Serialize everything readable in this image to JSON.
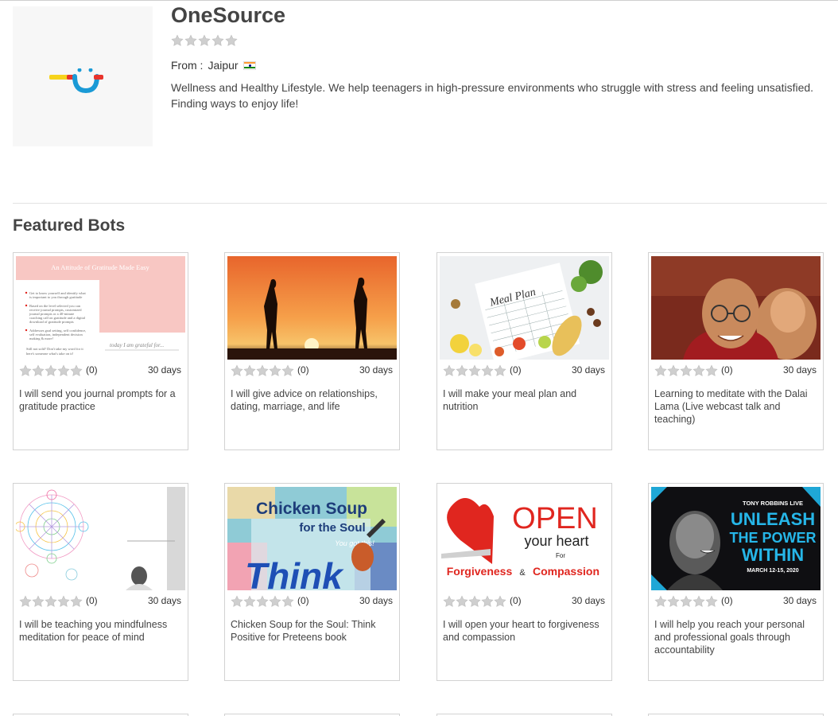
{
  "profile": {
    "name": "OneSource",
    "rating": 0,
    "from_label": "From :",
    "city": "Jaipur",
    "country_flag": "india-flag",
    "description": "Wellness and Healthy Lifestyle. We help teenagers in high-pressure environments who struggle with stress and feeling unsatisfied. Finding ways to enjoy life!"
  },
  "section_title": "Featured Bots",
  "cards": [
    {
      "title": "I will send you journal prompts for a gratitude practice",
      "rating": 0,
      "count": "(0)",
      "duration": "30 days",
      "thumb_heading": "An Attitude of Gratitude Made Easy",
      "thumb_bullets": [
        "Get to know yourself and identify what is important to you through gratitude",
        "Based on the level selected you can receive journal prompts, customized journal prompts or a 40-minute coaching call on gratitude and a digital download of gratitude prompts",
        "Addresses goal setting, self confidence, self evaluation, independent decision making & more!"
      ],
      "thumb_footer": "Still not sold? Don't take my word for it here's someone what's take on it!",
      "thumb_handwriting": "today I am grateful for..."
    },
    {
      "title": "I will give advice on relationships, dating, marriage, and life",
      "rating": 0,
      "count": "(0)",
      "duration": "30 days"
    },
    {
      "title": "I will make your meal plan and nutrition",
      "rating": 0,
      "count": "(0)",
      "duration": "30 days",
      "thumb_text": "Meal Plan"
    },
    {
      "title": "Learning to meditate with the Dalai Lama (Live webcast talk and teaching)",
      "rating": 0,
      "count": "(0)",
      "duration": "30 days"
    },
    {
      "title": "I will be teaching you mindfulness meditation for peace of mind",
      "rating": 0,
      "count": "(0)",
      "duration": "30 days"
    },
    {
      "title": "Chicken Soup for the Soul: Think Positive for Preteens book",
      "rating": 0,
      "count": "(0)",
      "duration": "30 days",
      "thumb_lines": [
        "Chicken Soup",
        "for the Soul",
        "You got this!",
        "Think"
      ]
    },
    {
      "title": "I will open your heart to forgiveness and compassion",
      "rating": 0,
      "count": "(0)",
      "duration": "30 days",
      "thumb_lines": [
        "OPEN",
        "your heart",
        "For",
        "Forgiveness",
        "&",
        "Compassion"
      ]
    },
    {
      "title": "I will help you reach your personal and professional goals through accountability",
      "rating": 0,
      "count": "(0)",
      "duration": "30 days",
      "thumb_lines": [
        "TONY ROBBINS LIVE",
        "UNLEASH",
        "THE POWER",
        "WITHIN",
        "MARCH 12-15, 2020"
      ]
    }
  ],
  "colors": {
    "accent_red": "#e0261f",
    "star_empty": "#cfcfcf"
  }
}
